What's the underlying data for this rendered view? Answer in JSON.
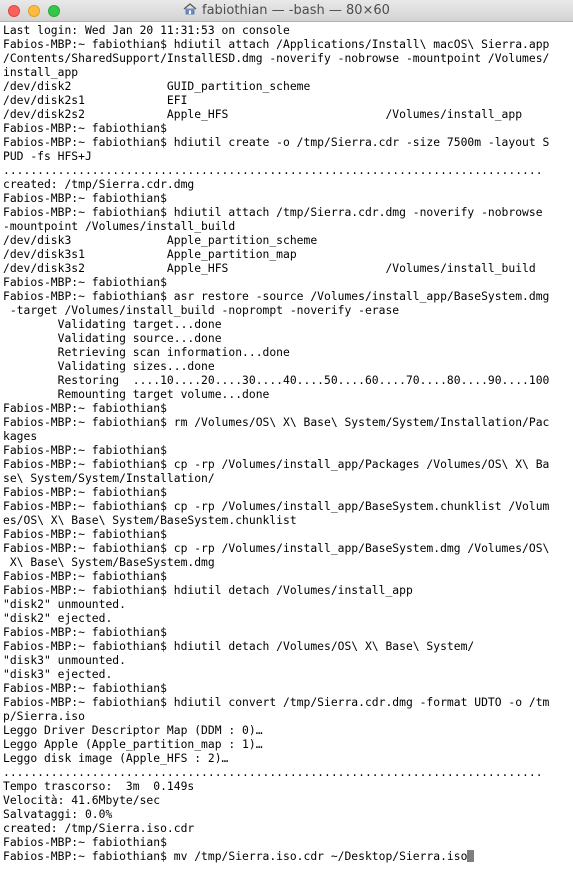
{
  "window": {
    "title": "fabiothian — -bash — 80×60"
  },
  "terminal": {
    "lines": [
      "Last login: Wed Jan 20 11:31:53 on console",
      "Fabios-MBP:~ fabiothian$ hdiutil attach /Applications/Install\\ macOS\\ Sierra.app",
      "/Contents/SharedSupport/InstallESD.dmg -noverify -nobrowse -mountpoint /Volumes/",
      "install_app",
      "/dev/disk2              GUID_partition_scheme",
      "/dev/disk2s1            EFI",
      "/dev/disk2s2            Apple_HFS                       /Volumes/install_app",
      "Fabios-MBP:~ fabiothian$",
      "Fabios-MBP:~ fabiothian$ hdiutil create -o /tmp/Sierra.cdr -size 7500m -layout S",
      "PUD -fs HFS+J",
      "...............................................................................",
      "created: /tmp/Sierra.cdr.dmg",
      "Fabios-MBP:~ fabiothian$",
      "Fabios-MBP:~ fabiothian$ hdiutil attach /tmp/Sierra.cdr.dmg -noverify -nobrowse",
      "-mountpoint /Volumes/install_build",
      "/dev/disk3              Apple_partition_scheme",
      "/dev/disk3s1            Apple_partition_map",
      "/dev/disk3s2            Apple_HFS                       /Volumes/install_build",
      "Fabios-MBP:~ fabiothian$",
      "Fabios-MBP:~ fabiothian$ asr restore -source /Volumes/install_app/BaseSystem.dmg",
      " -target /Volumes/install_build -noprompt -noverify -erase",
      "        Validating target...done",
      "        Validating source...done",
      "        Retrieving scan information...done",
      "        Validating sizes...done",
      "        Restoring  ....10....20....30....40....50....60....70....80....90....100",
      "        Remounting target volume...done",
      "Fabios-MBP:~ fabiothian$",
      "Fabios-MBP:~ fabiothian$ rm /Volumes/OS\\ X\\ Base\\ System/System/Installation/Pac",
      "kages",
      "Fabios-MBP:~ fabiothian$",
      "Fabios-MBP:~ fabiothian$ cp -rp /Volumes/install_app/Packages /Volumes/OS\\ X\\ Ba",
      "se\\ System/System/Installation/",
      "Fabios-MBP:~ fabiothian$",
      "Fabios-MBP:~ fabiothian$ cp -rp /Volumes/install_app/BaseSystem.chunklist /Volum",
      "es/OS\\ X\\ Base\\ System/BaseSystem.chunklist",
      "Fabios-MBP:~ fabiothian$",
      "Fabios-MBP:~ fabiothian$ cp -rp /Volumes/install_app/BaseSystem.dmg /Volumes/OS\\",
      " X\\ Base\\ System/BaseSystem.dmg",
      "Fabios-MBP:~ fabiothian$",
      "Fabios-MBP:~ fabiothian$ hdiutil detach /Volumes/install_app",
      "\"disk2\" unmounted.",
      "\"disk2\" ejected.",
      "Fabios-MBP:~ fabiothian$",
      "Fabios-MBP:~ fabiothian$ hdiutil detach /Volumes/OS\\ X\\ Base\\ System/",
      "\"disk3\" unmounted.",
      "\"disk3\" ejected.",
      "Fabios-MBP:~ fabiothian$",
      "Fabios-MBP:~ fabiothian$ hdiutil convert /tmp/Sierra.cdr.dmg -format UDTO -o /tm",
      "p/Sierra.iso",
      "Leggo Driver Descriptor Map (DDM : 0)…",
      "Leggo Apple (Apple_partition_map : 1)…",
      "Leggo disk image (Apple_HFS : 2)…",
      "...............................................................................",
      "Tempo trascorso:  3m  0.149s",
      "Velocità: 41.6Mbyte/sec",
      "Salvataggi: 0.0%",
      "created: /tmp/Sierra.iso.cdr",
      "Fabios-MBP:~ fabiothian$",
      "Fabios-MBP:~ fabiothian$ mv /tmp/Sierra.iso.cdr ~/Desktop/Sierra.iso"
    ]
  },
  "icons": {
    "title_icon": "home-folder-icon",
    "close": "close-button",
    "minimize": "minimize-button",
    "maximize": "zoom-button"
  },
  "colors": {
    "close": "#fc605c",
    "minimize": "#fdbc40",
    "maximize": "#34c84a",
    "text": "#000000",
    "background": "#ffffff",
    "cursor": "#7f7f7f"
  }
}
